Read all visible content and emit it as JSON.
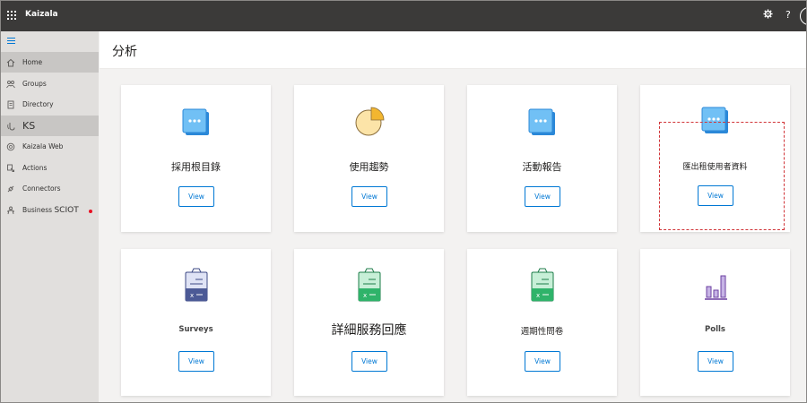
{
  "app": {
    "title": "Kaizala"
  },
  "topbar_icons": {
    "settings": "gear-icon",
    "help_glyph": "?"
  },
  "sidebar": {
    "items": [
      {
        "label": "Home",
        "icon": "home-icon",
        "selected": true
      },
      {
        "label": "Groups",
        "icon": "groups-icon",
        "selected": false
      },
      {
        "label": "Directory",
        "icon": "directory-icon",
        "selected": false
      },
      {
        "label": "KS",
        "icon": "ks-icon",
        "selected": true
      },
      {
        "label": "Kaizala Web",
        "icon": "web-icon",
        "selected": false
      },
      {
        "label": "Actions",
        "icon": "actions-icon",
        "selected": false
      },
      {
        "label": "Connectors",
        "icon": "connectors-icon",
        "selected": false
      },
      {
        "label_prefix": "Business ",
        "label_suffix": "SCIOT",
        "icon": "business-icon",
        "selected": false,
        "has_alert": true
      }
    ]
  },
  "main": {
    "title": "分析",
    "cards": [
      {
        "label": "採用根目錄",
        "icon": "chat-icon",
        "button": "View"
      },
      {
        "label": "使用趨勢",
        "icon": "pie-chart-icon",
        "button": "View"
      },
      {
        "label": "活動報告",
        "icon": "chat-icon",
        "button": "View"
      },
      {
        "label": "匯出租使用者資料",
        "icon": "chat-icon",
        "button": "View",
        "highlighted": true
      },
      {
        "label": "Surveys",
        "icon": "survey-clipboard-icon",
        "button": "View"
      },
      {
        "label": "詳細服務回應",
        "icon": "green-clipboard-icon",
        "button": "View"
      },
      {
        "label": "週期性問卷",
        "icon": "green-clipboard-icon",
        "button": "View"
      },
      {
        "label": "Polls",
        "icon": "bar-chart-icon",
        "button": "View"
      }
    ]
  },
  "colors": {
    "topbar": "#3b3a39",
    "accent": "#0078d4",
    "sidebar": "#e1dfdd",
    "alert": "#e81123",
    "highlight_border": "#d13438"
  }
}
